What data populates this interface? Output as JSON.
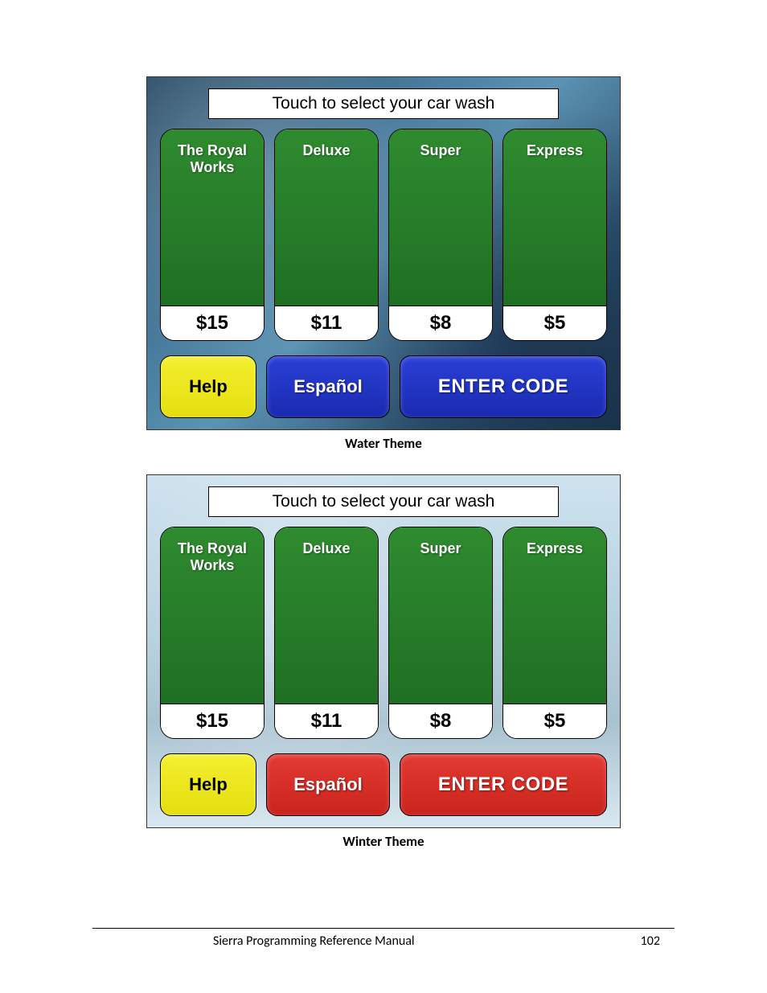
{
  "footer": {
    "title": "Sierra Programming Reference Manual",
    "page": "102"
  },
  "themes": [
    {
      "id": "water",
      "caption": "Water Theme",
      "prompt": "Touch to select your car wash",
      "accent": "blue",
      "options": [
        {
          "name": "The Royal Works",
          "price": "$15"
        },
        {
          "name": "Deluxe",
          "price": "$11"
        },
        {
          "name": "Super",
          "price": "$8"
        },
        {
          "name": "Express",
          "price": "$5"
        }
      ],
      "help_label": "Help",
      "lang_label": "Español",
      "code_label": "ENTER CODE"
    },
    {
      "id": "winter",
      "caption": "Winter Theme",
      "prompt": "Touch to select your car wash",
      "accent": "red",
      "options": [
        {
          "name": "The Royal Works",
          "price": "$15"
        },
        {
          "name": "Deluxe",
          "price": "$11"
        },
        {
          "name": "Super",
          "price": "$8"
        },
        {
          "name": "Express",
          "price": "$5"
        }
      ],
      "help_label": "Help",
      "lang_label": "Español",
      "code_label": "ENTER CODE"
    }
  ]
}
